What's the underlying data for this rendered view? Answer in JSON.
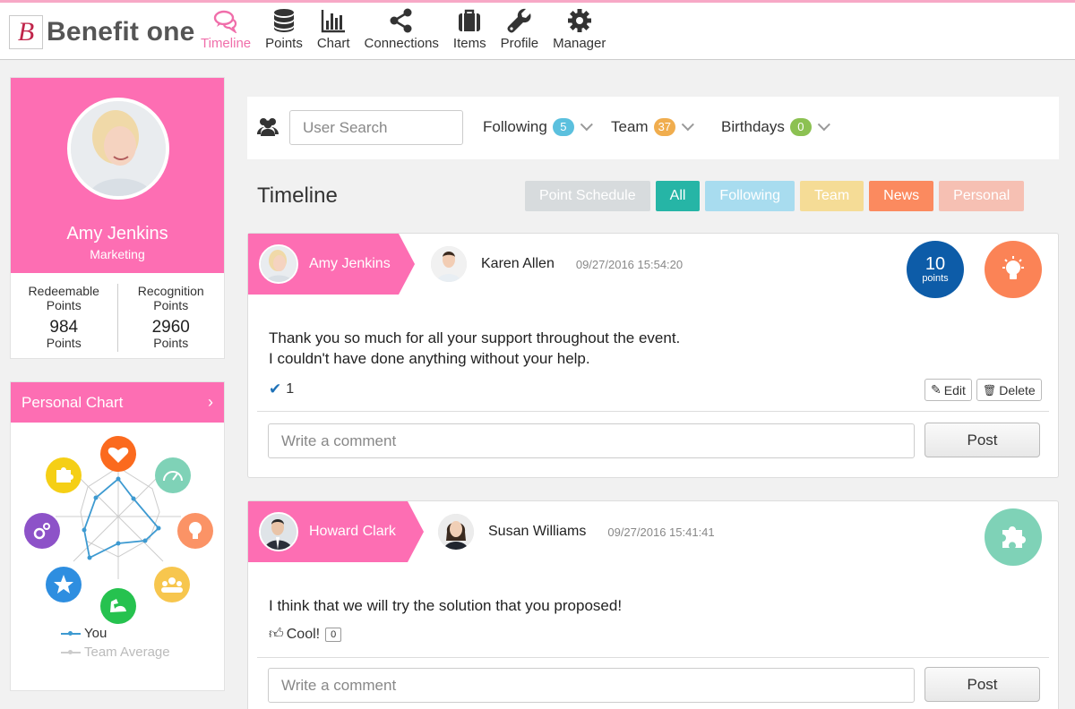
{
  "app": {
    "logo_letter": "B",
    "logo_text": "Benefit one",
    "accent": "#fd6eb3"
  },
  "nav": {
    "items": [
      {
        "label": "Timeline",
        "icon": "comments-icon",
        "active": true
      },
      {
        "label": "Points",
        "icon": "database-icon"
      },
      {
        "label": "Chart",
        "icon": "bar-chart-icon"
      },
      {
        "label": "Connections",
        "icon": "share-icon"
      },
      {
        "label": "Items",
        "icon": "briefcase-icon"
      },
      {
        "label": "Profile",
        "icon": "wrench-icon"
      },
      {
        "label": "Manager",
        "icon": "gear-icon"
      }
    ]
  },
  "profile": {
    "name": "Amy Jenkins",
    "department": "Marketing",
    "redeemable_label_1": "Redeemable",
    "redeemable_label_2": "Points",
    "redeemable_value": "984",
    "redeemable_unit": "Points",
    "recognition_label_1": "Recognition",
    "recognition_label_2": "Points",
    "recognition_value": "2960",
    "recognition_unit": "Points"
  },
  "personal_chart": {
    "title": "Personal Chart",
    "chevron": "›",
    "icons": [
      "heart-hand-icon",
      "speedometer-icon",
      "lightbulb-icon",
      "group-icon",
      "muscle-icon",
      "star-icon",
      "gears-icon",
      "puzzle-icon"
    ],
    "legend_you": "You",
    "legend_team": "Team Average",
    "you_color": "#3d9ad1",
    "team_color": "#cccccc"
  },
  "search": {
    "placeholder": "User Search",
    "following_label": "Following",
    "following_count": "5",
    "team_label": "Team",
    "team_count": "37",
    "birthdays_label": "Birthdays",
    "birthdays_count": "0"
  },
  "timeline": {
    "title": "Timeline",
    "tabs": [
      {
        "label": "Point Schedule",
        "color": "#d7dbdd"
      },
      {
        "label": "All",
        "color": "#26b5a6"
      },
      {
        "label": "Following",
        "color": "#a8dcef"
      },
      {
        "label": "Team",
        "color": "#f5dc96"
      },
      {
        "label": "News",
        "color": "#fb8a5f"
      },
      {
        "label": "Personal",
        "color": "#f6c0b3"
      }
    ]
  },
  "posts": [
    {
      "from": "Amy Jenkins",
      "to": "Karen Allen",
      "time": "09/27/2016 15:54:20",
      "points_value": "10",
      "points_unit": "points",
      "category_icon": "lightbulb-icon",
      "text_line1": "Thank you so much for all your support throughout the event.",
      "text_line2": "I couldn't have done anything without your help.",
      "likes": "1",
      "edit_label": "Edit",
      "delete_label": "Delete",
      "comment_placeholder": "Write a comment",
      "post_label": "Post"
    },
    {
      "from": "Howard Clark",
      "to": "Susan Williams",
      "time": "09/27/2016 15:41:41",
      "category_icon": "puzzle-icon",
      "text_line1": "I think that we will try the solution that you proposed!",
      "cool_label": "Cool!",
      "cool_count": "0",
      "comment_placeholder": "Write a comment",
      "post_label": "Post"
    }
  ]
}
